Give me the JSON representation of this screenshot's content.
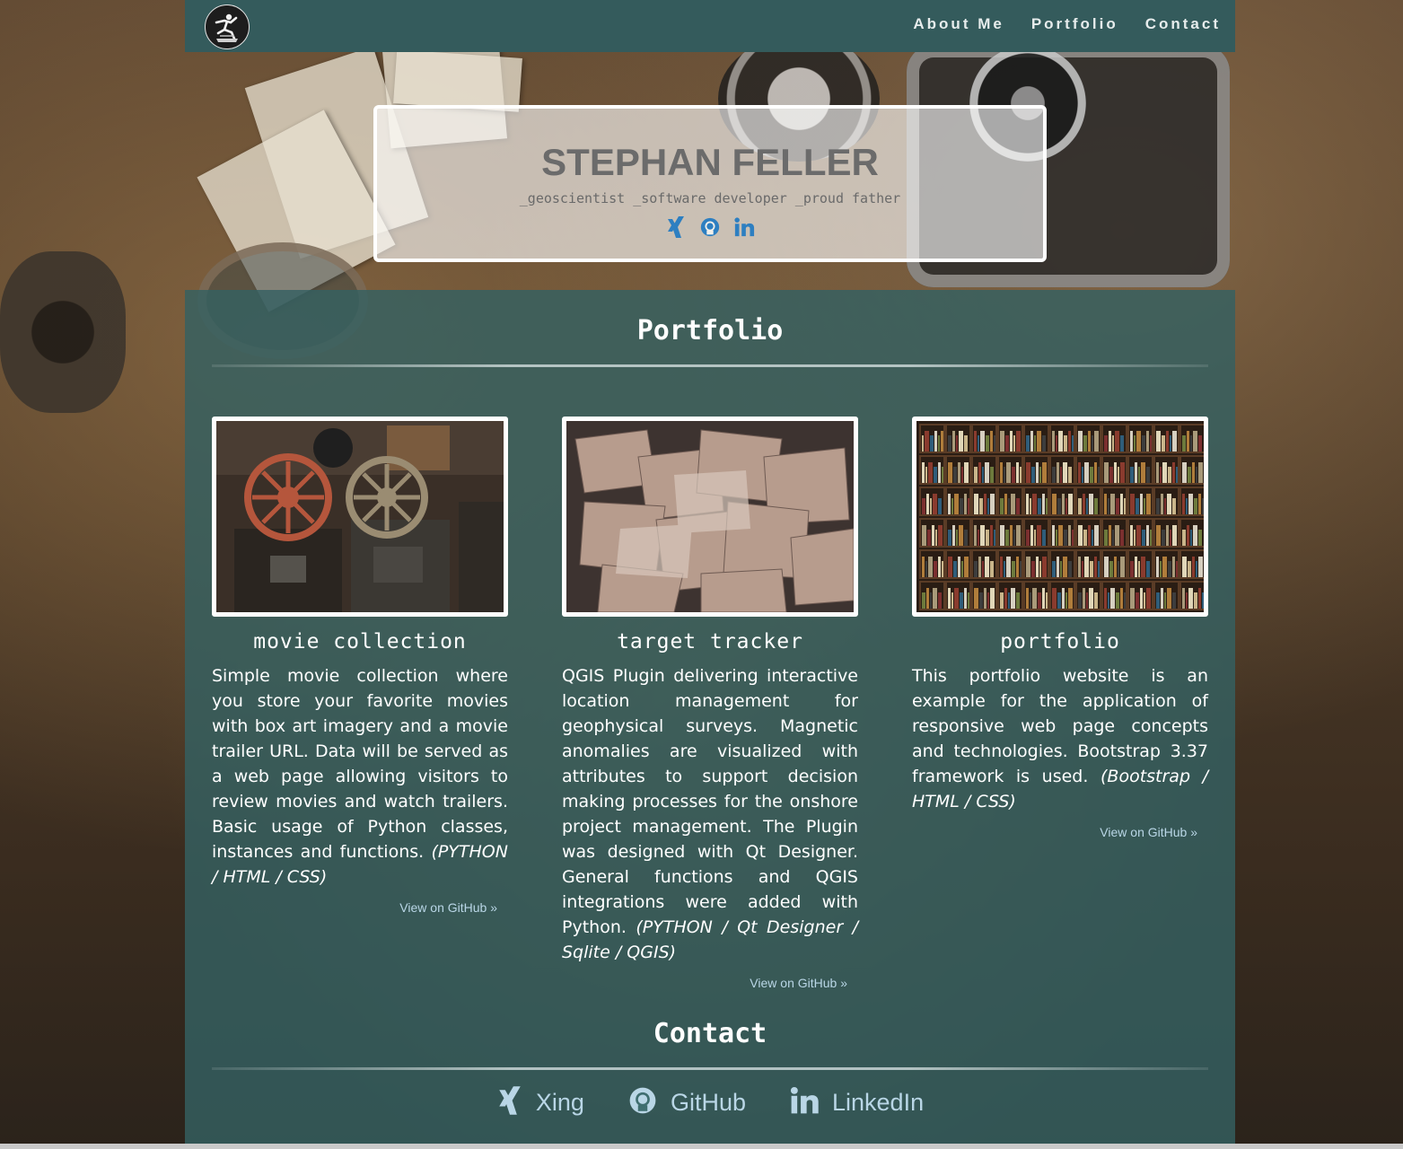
{
  "colors": {
    "navbar": "#345b5c",
    "panel": "#346062",
    "link": "#b9d6e6",
    "icon_blue": "#2d7fc1"
  },
  "nav": {
    "logo_icon": "runner-logo-icon",
    "links": [
      {
        "label": "About Me"
      },
      {
        "label": "Portfolio"
      },
      {
        "label": "Contact"
      }
    ]
  },
  "hero": {
    "name": "STEPHAN FELLER",
    "tagline": "_geoscientist _software developer _proud father",
    "socials": [
      "xing-icon",
      "github-icon",
      "linkedin-icon"
    ]
  },
  "portfolio": {
    "title": "Portfolio",
    "projects": [
      {
        "title": "movie collection",
        "description": "Simple movie collection where you store your favorite movies with box art imagery and a movie trailer URL. Data will be served as a web page allowing visitors to review movies and watch trailers. Basic usage of Python classes, instances and functions.",
        "tech": "(PYTHON / HTML / CSS)",
        "link": "View on GitHub »",
        "image": "film-reels-image"
      },
      {
        "title": "target tracker",
        "description": "QGIS Plugin delivering interactive location management for geophysical surveys. Magnetic anomalies are visualized with attributes to support decision making processes for the onshore project management. The Plugin was designed with Qt Designer. General functions and QGIS integrations were added with Python.",
        "tech": "(PYTHON / Qt Designer / Sqlite / QGIS)",
        "link": "View on GitHub »",
        "image": "scattered-maps-image"
      },
      {
        "title": "portfolio",
        "description": "This portfolio website is an example for the application of responsive web page concepts and technologies. Bootstrap 3.37 framework is used.",
        "tech": "(Bootstrap / HTML / CSS)",
        "link": "View on GitHub »",
        "image": "bookshelf-image"
      }
    ]
  },
  "contact": {
    "title": "Contact",
    "items": [
      {
        "label": "Xing",
        "icon": "xing-icon"
      },
      {
        "label": "GitHub",
        "icon": "github-icon"
      },
      {
        "label": "LinkedIn",
        "icon": "linkedin-icon"
      }
    ]
  }
}
